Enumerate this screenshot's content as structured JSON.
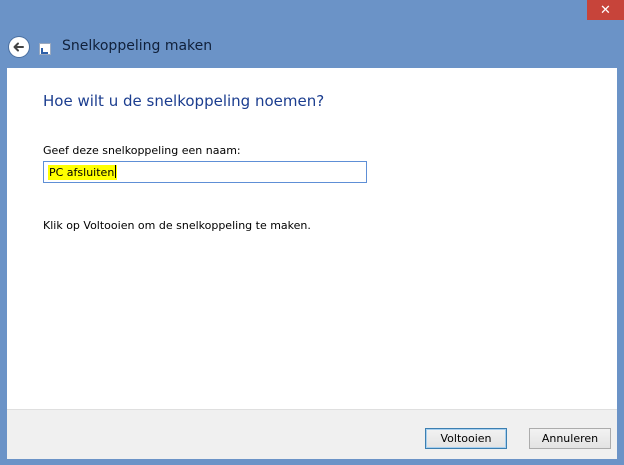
{
  "window": {
    "title": "Snelkoppeling maken",
    "close_label": "✕"
  },
  "content": {
    "heading": "Hoe wilt u de snelkoppeling noemen?",
    "field_label": "Geef deze snelkoppeling een naam:",
    "name_value": "PC afsluiten",
    "instruction": "Klik op Voltooien om de snelkoppeling te maken."
  },
  "buttons": {
    "finish_label": "Voltooien",
    "cancel_label": "Annuleren"
  },
  "colors": {
    "accent": "#1b3d8f",
    "frame": "#6b93c7",
    "close": "#c7443a",
    "highlight": "#ffff00"
  },
  "icons": {
    "back": "back-arrow-icon",
    "shortcut": "shortcut-icon",
    "close": "close-icon"
  }
}
